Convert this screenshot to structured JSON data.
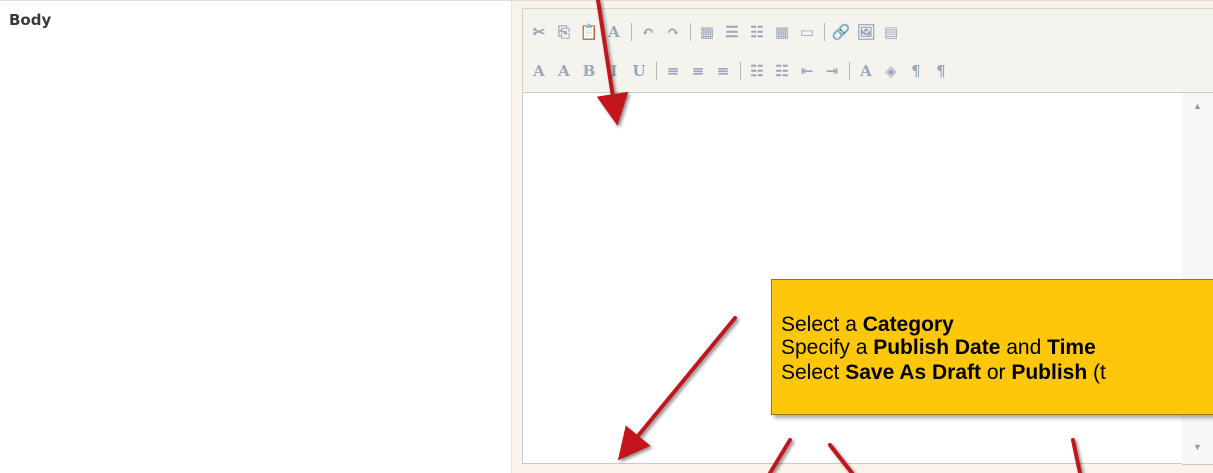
{
  "form": {
    "body_label": "Body"
  },
  "editor": {
    "toolbar_row1": [
      {
        "name": "cut-icon",
        "glyph": "✂"
      },
      {
        "name": "copy-icon",
        "glyph": "⎘"
      },
      {
        "name": "paste-icon",
        "glyph": "📋"
      },
      {
        "name": "spellcheck-icon",
        "glyph": "A"
      },
      {
        "sep": true
      },
      {
        "name": "undo-icon",
        "glyph": "↶"
      },
      {
        "name": "redo-icon",
        "glyph": "↷"
      },
      {
        "sep": true
      },
      {
        "name": "table-icon",
        "glyph": "▦"
      },
      {
        "name": "insert-list-dropdown-icon",
        "glyph": "☰"
      },
      {
        "name": "insert-item-dropdown-icon",
        "glyph": "☷"
      },
      {
        "name": "grid-icon",
        "glyph": "▦"
      },
      {
        "name": "layout-icon",
        "glyph": "▭"
      },
      {
        "sep": true
      },
      {
        "name": "link-icon",
        "glyph": "🔗"
      },
      {
        "name": "image-icon",
        "glyph": "🖼"
      },
      {
        "name": "form-icon",
        "glyph": "▤"
      }
    ],
    "toolbar_row2": [
      {
        "name": "font-color-a-icon",
        "glyph": "A"
      },
      {
        "name": "font-size-icon",
        "glyph": "A"
      },
      {
        "name": "bold-icon",
        "glyph": "B"
      },
      {
        "name": "italic-icon",
        "glyph": "I"
      },
      {
        "name": "underline-icon",
        "glyph": "U"
      },
      {
        "sep": true
      },
      {
        "name": "align-left-icon",
        "glyph": "≡"
      },
      {
        "name": "align-center-icon",
        "glyph": "≡"
      },
      {
        "name": "align-right-icon",
        "glyph": "≡"
      },
      {
        "sep": true
      },
      {
        "name": "numbered-list-icon",
        "glyph": "☷"
      },
      {
        "name": "bullet-list-icon",
        "glyph": "☷"
      },
      {
        "name": "outdent-icon",
        "glyph": "⇤"
      },
      {
        "name": "indent-icon",
        "glyph": "⇥"
      },
      {
        "sep": true
      },
      {
        "name": "text-color-icon",
        "glyph": "A"
      },
      {
        "name": "highlight-icon",
        "glyph": "◈"
      },
      {
        "name": "ltr-icon",
        "glyph": "¶"
      },
      {
        "name": "rtl-icon",
        "glyph": "¶"
      }
    ],
    "colors": {
      "callout_bg": "#ffc70a",
      "arrow": "#c2151b"
    }
  },
  "callout": {
    "line1_a": "Select a ",
    "line1_b": "Category",
    "line2_a": "Specify a ",
    "line2_b": "Publish Date",
    "line2_c": " and ",
    "line2_d": "Time",
    "line3_a": "Select ",
    "line3_b": "Save As Draft",
    "line3_c": " or ",
    "line3_d": "Publish",
    "line3_e": " (t"
  }
}
